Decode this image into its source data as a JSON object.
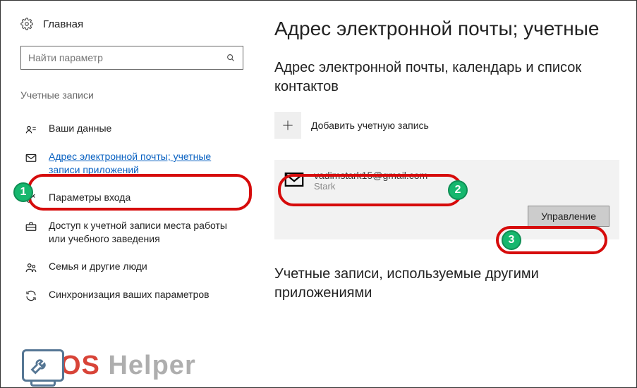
{
  "sidebar": {
    "home_label": "Главная",
    "search_placeholder": "Найти параметр",
    "section_title": "Учетные записи",
    "items": [
      {
        "label": "Ваши данные"
      },
      {
        "label": "Адрес электронной почты; учетные записи приложений"
      },
      {
        "label": "Параметры входа"
      },
      {
        "label": "Доступ к учетной записи места работы или учебного заведения"
      },
      {
        "label": "Семья и другие люди"
      },
      {
        "label": "Синхронизация ваших параметров"
      }
    ]
  },
  "main": {
    "title": "Адрес электронной почты; учетные",
    "subtitle1": "Адрес электронной почты, календарь и список контактов",
    "add_account_label": "Добавить учетную запись",
    "account": {
      "email": "vadimstark15@gmail.com",
      "name": "Stark"
    },
    "manage_label": "Управление",
    "subtitle2": "Учетные записи, используемые другими приложениями"
  },
  "annotations": {
    "badge1": "1",
    "badge2": "2",
    "badge3": "3"
  },
  "watermark": {
    "part1": "OS",
    "part2": " Helper"
  }
}
